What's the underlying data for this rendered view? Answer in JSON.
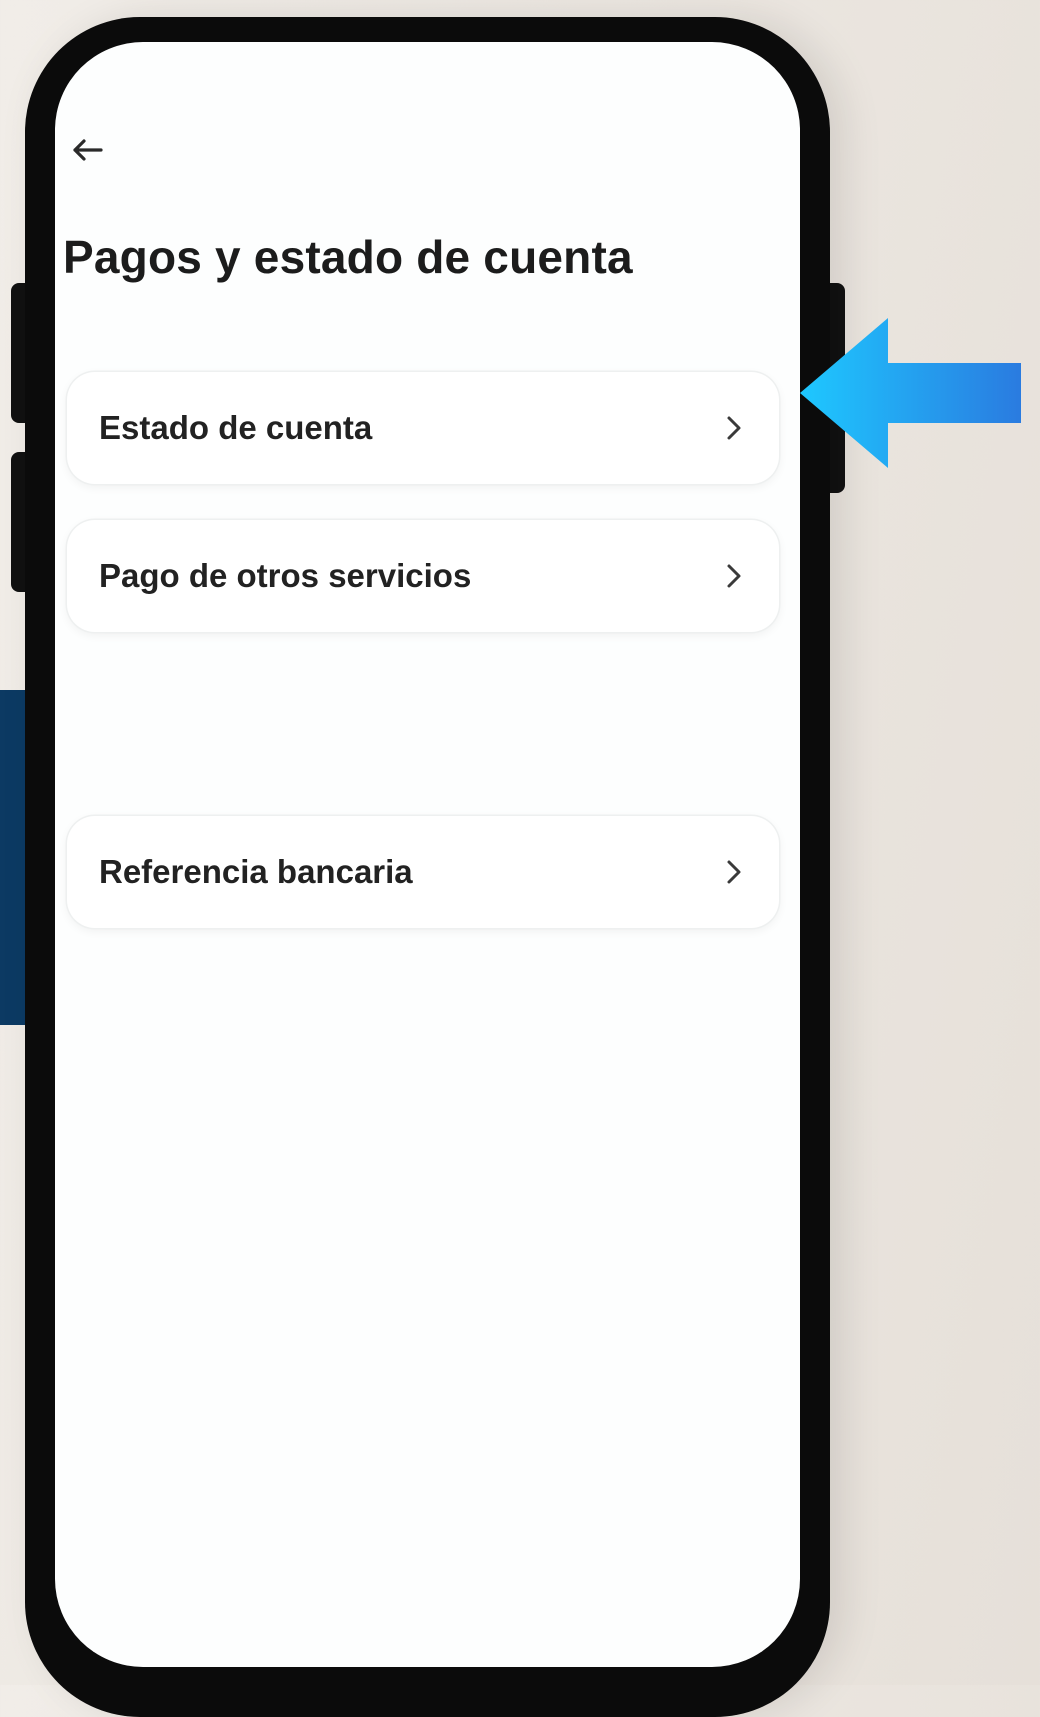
{
  "header": {
    "back_icon": "arrow-left-icon",
    "title": "Pagos y estado de cuenta"
  },
  "menu": {
    "items": [
      {
        "label": "Estado de cuenta",
        "icon": "chevron-right-icon"
      },
      {
        "label": "Pago de otros servicios",
        "icon": "chevron-right-icon"
      },
      {
        "label": "Referencia bancaria",
        "icon": "chevron-right-icon"
      }
    ]
  },
  "annotation": {
    "icon": "pointer-arrow-icon",
    "points_to": "Estado de cuenta"
  },
  "colors": {
    "arrow_start": "#1ec8ff",
    "arrow_end": "#2a7be0",
    "background_panel": "#0c3a63",
    "phone_frame": "#0b0b0b",
    "screen": "#fdfefe",
    "text": "#1c1c1c"
  }
}
